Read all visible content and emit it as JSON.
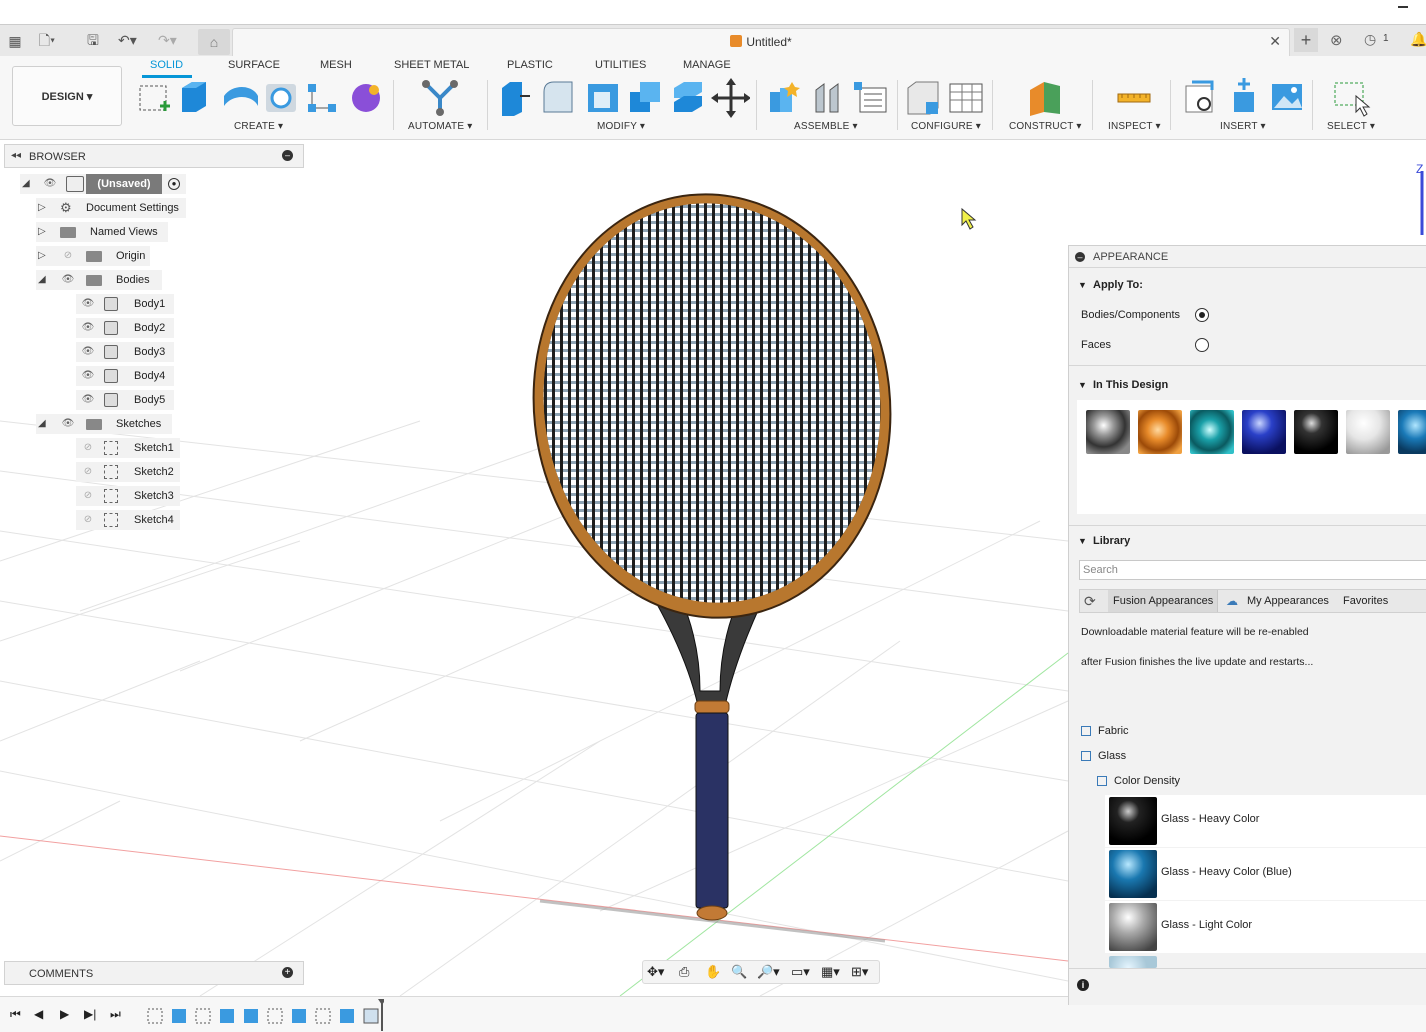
{
  "app": {
    "doc_title": "Untitled*",
    "notif_count": "1"
  },
  "ribbon": {
    "design_label": "DESIGN ▾",
    "tabs": [
      "SOLID",
      "SURFACE",
      "MESH",
      "SHEET METAL",
      "PLASTIC",
      "UTILITIES",
      "MANAGE"
    ],
    "groups": {
      "create": "CREATE ▾",
      "automate": "AUTOMATE ▾",
      "modify": "MODIFY ▾",
      "assemble": "ASSEMBLE ▾",
      "configure": "CONFIGURE ▾",
      "construct": "CONSTRUCT ▾",
      "inspect": "INSPECT ▾",
      "insert": "INSERT ▾",
      "select": "SELECT ▾"
    }
  },
  "browser": {
    "title": "BROWSER",
    "root": "(Unsaved)",
    "items": [
      "Document Settings",
      "Named Views",
      "Origin",
      "Bodies",
      "Sketches"
    ],
    "bodies": [
      "Body1",
      "Body2",
      "Body3",
      "Body4",
      "Body5"
    ],
    "sketches": [
      "Sketch1",
      "Sketch2",
      "Sketch3",
      "Sketch4"
    ]
  },
  "comments": {
    "title": "COMMENTS"
  },
  "appearance": {
    "title": "APPEARANCE",
    "apply_to": "Apply To:",
    "option_bodies": "Bodies/Components",
    "option_faces": "Faces",
    "in_design": "In This Design",
    "library": "Library",
    "search_placeholder": "Search",
    "tab_fusion": "Fusion Appearances",
    "tab_my": "My Appearances",
    "tab_fav": "Favorites",
    "msg1": "Downloadable material feature will be re-enabled",
    "msg2": "after Fusion finishes the live update and restarts...",
    "cat_fabric": "Fabric",
    "cat_glass": "Glass",
    "cat_color_density": "Color Density",
    "materials": [
      "Glass - Heavy Color",
      "Glass - Heavy Color (Blue)",
      "Glass - Light Color"
    ]
  },
  "viewcube": {
    "z_label": "Z"
  },
  "colors": {
    "accent": "#0696d7",
    "frame": "#b8772e",
    "grip": "#2a3264",
    "throat": "#3a3a3a"
  }
}
